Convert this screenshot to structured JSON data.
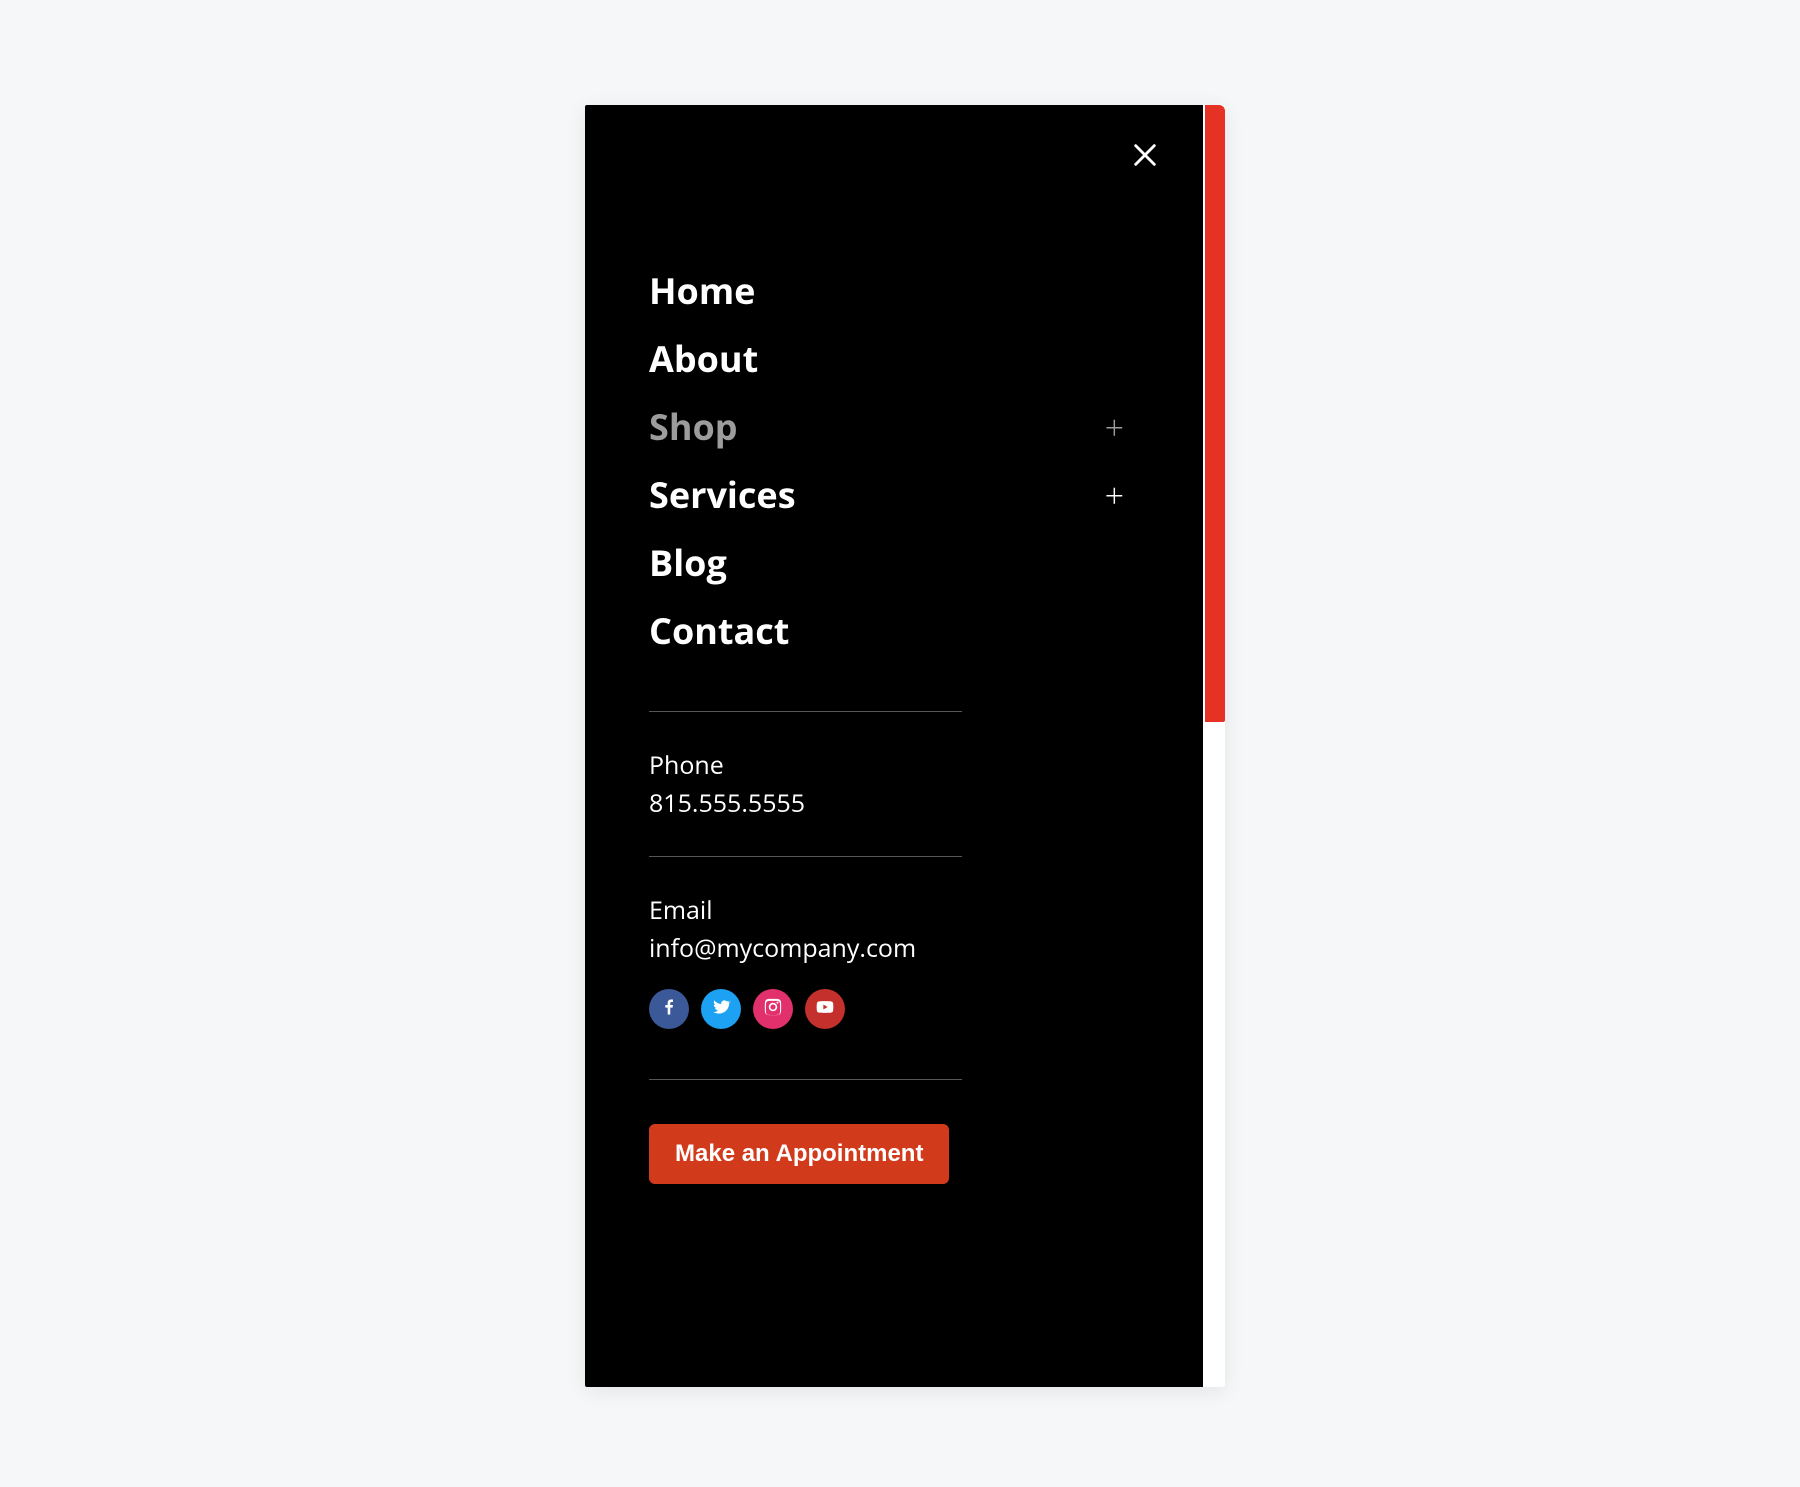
{
  "nav": {
    "items": [
      {
        "label": "Home",
        "expandable": false,
        "muted": false
      },
      {
        "label": "About",
        "expandable": false,
        "muted": false
      },
      {
        "label": "Shop",
        "expandable": true,
        "muted": true
      },
      {
        "label": "Services",
        "expandable": true,
        "muted": false
      },
      {
        "label": "Blog",
        "expandable": false,
        "muted": false
      },
      {
        "label": "Contact",
        "expandable": false,
        "muted": false
      }
    ]
  },
  "contact": {
    "phone_label": "Phone",
    "phone_value": "815.555.5555",
    "email_label": "Email",
    "email_value": "info@mycompany.com"
  },
  "socials": {
    "facebook": "facebook",
    "twitter": "twitter",
    "instagram": "instagram",
    "youtube": "youtube"
  },
  "cta": {
    "label": "Make an Appointment"
  },
  "colors": {
    "accent": "#d23a1c",
    "scrollbar": "#e63224"
  },
  "glyphs": {
    "expand": "+"
  }
}
